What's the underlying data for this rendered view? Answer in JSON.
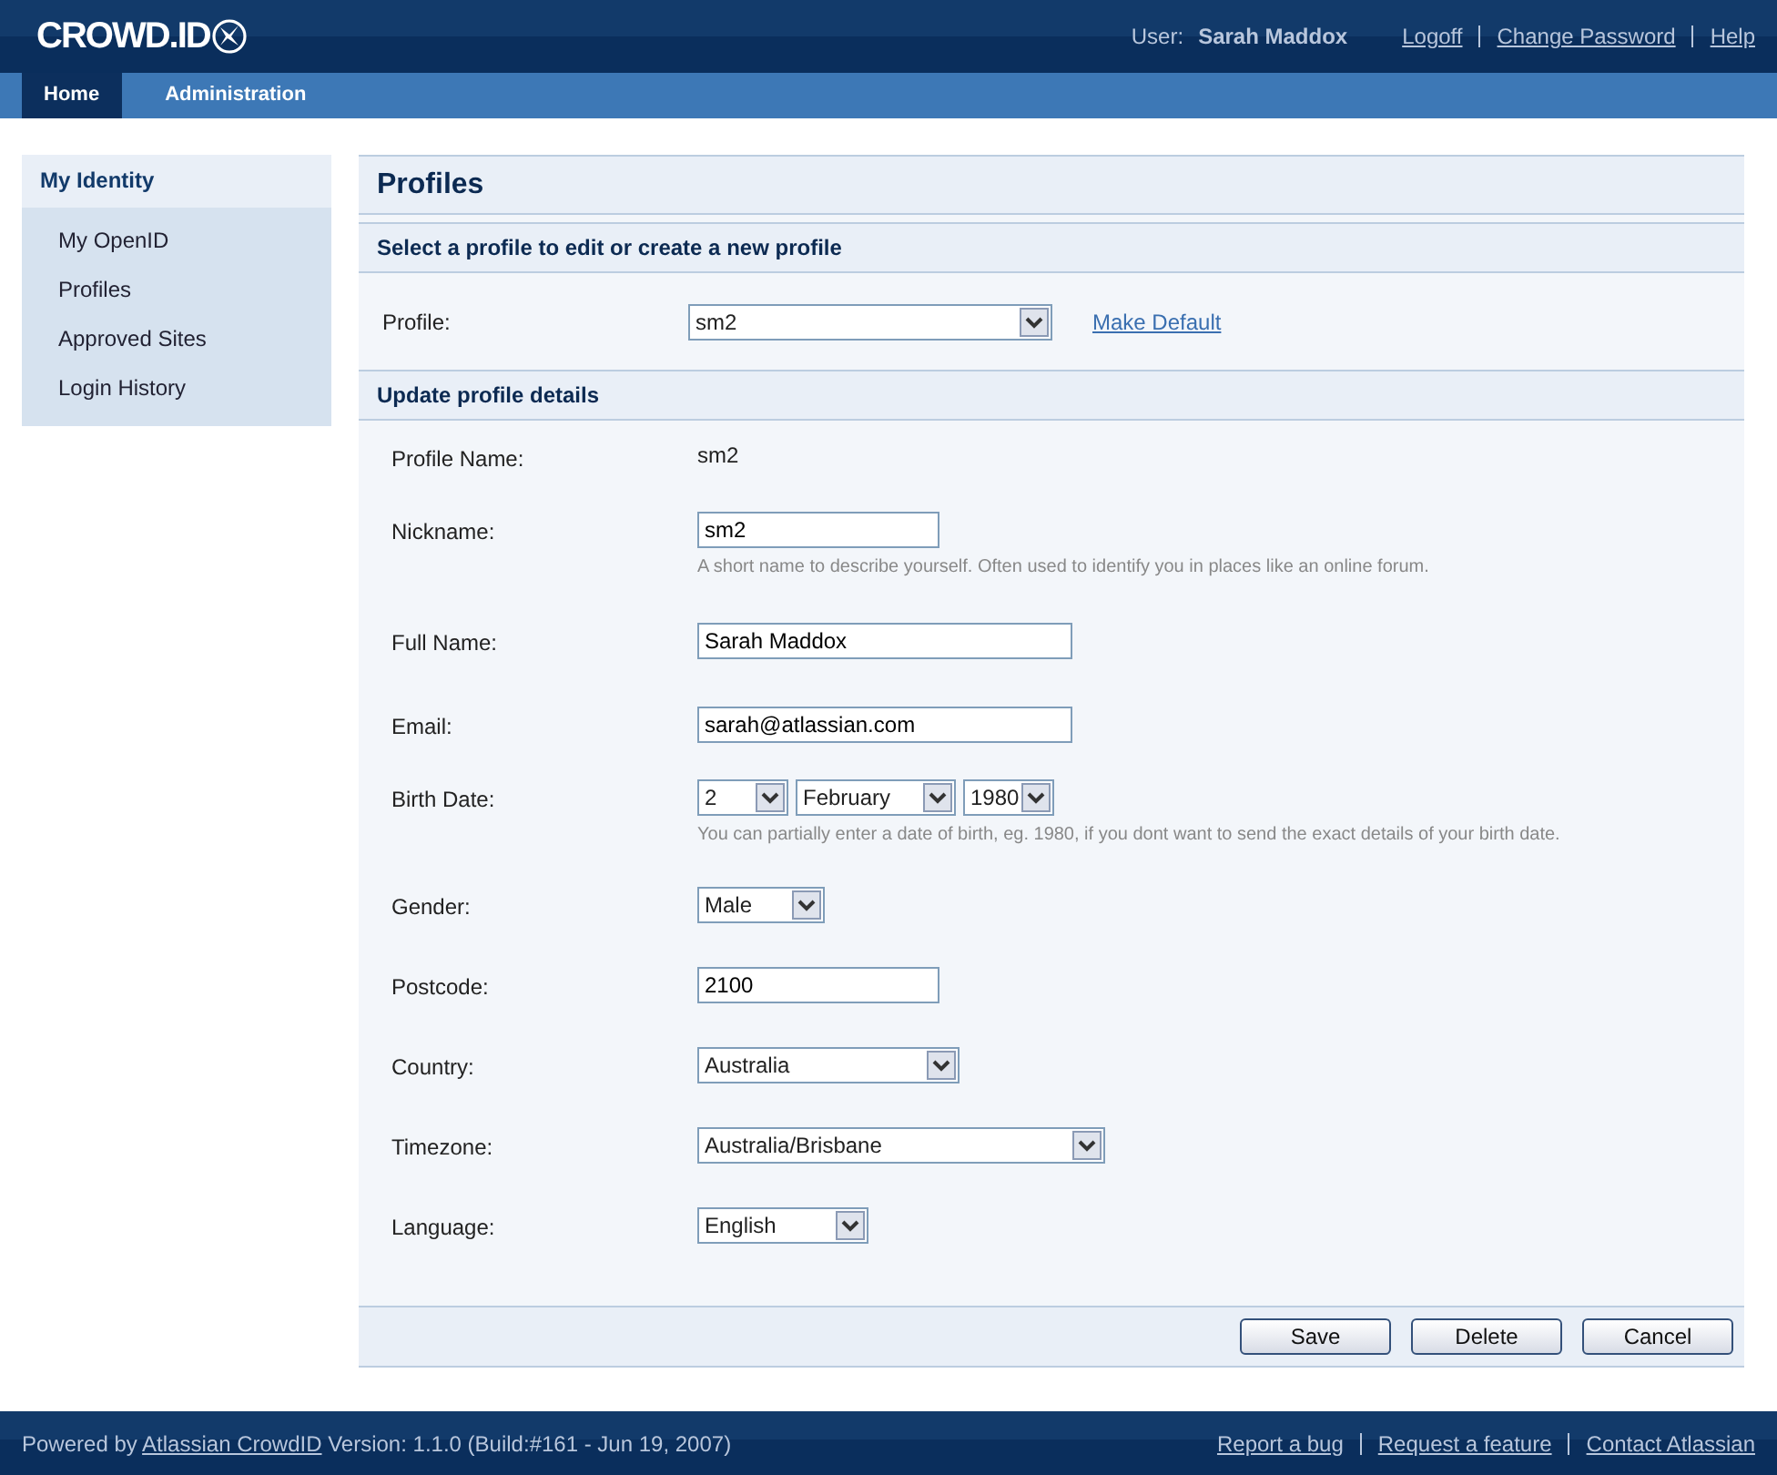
{
  "header": {
    "logo": "CROWD.ID",
    "user_label": "User:",
    "user_name": "Sarah Maddox",
    "links": [
      "Logoff",
      "Change Password",
      "Help"
    ]
  },
  "nav": [
    {
      "label": "Home",
      "selected": true
    },
    {
      "label": "Administration",
      "selected": false
    }
  ],
  "sidebar": {
    "title": "My Identity",
    "items": [
      {
        "label": "My OpenID",
        "selected": false
      },
      {
        "label": "Profiles",
        "selected": false
      },
      {
        "label": "Approved Sites",
        "selected": false
      },
      {
        "label": "Login History",
        "selected": false
      }
    ]
  },
  "page": {
    "title": "Profiles",
    "select_section": "Select a profile to edit or create a new profile",
    "profile_label": "Profile:",
    "profile_value": "sm2",
    "make_default": "Make Default",
    "details_section": "Update profile details",
    "fields": [
      {
        "kind": "static",
        "label": "Profile Name:",
        "value": "sm2"
      },
      {
        "kind": "text",
        "label": "Nickname:",
        "value": "sm2",
        "hint": "A short name to describe yourself. Often used to identify you in places like an online forum."
      },
      {
        "kind": "text",
        "label": "Full Name:",
        "value": "Sarah Maddox"
      },
      {
        "kind": "text",
        "label": "Email:",
        "value": "sarah@atlassian.com"
      },
      {
        "kind": "date",
        "label": "Birth Date:",
        "parts": [
          "2",
          "February",
          "1980"
        ],
        "hint": "You can partially enter a date of birth, eg. 1980, if you dont want to send the exact details of your birth date."
      },
      {
        "kind": "select",
        "label": "Gender:",
        "value": "Male"
      },
      {
        "kind": "text",
        "label": "Postcode:",
        "value": "2100"
      },
      {
        "kind": "select",
        "label": "Country:",
        "value": "Australia"
      },
      {
        "kind": "select",
        "label": "Timezone:",
        "value": "Australia/Brisbane"
      },
      {
        "kind": "select",
        "label": "Language:",
        "value": "English"
      }
    ],
    "buttons": [
      "Save",
      "Delete",
      "Cancel"
    ]
  },
  "footer": {
    "powered": "Powered by",
    "product": "Atlassian CrowdID",
    "version": "Version: 1.1.0 (Build:#161 - Jun 19, 2007)",
    "links": [
      "Report a bug",
      "Request a feature",
      "Contact Atlassian"
    ]
  }
}
